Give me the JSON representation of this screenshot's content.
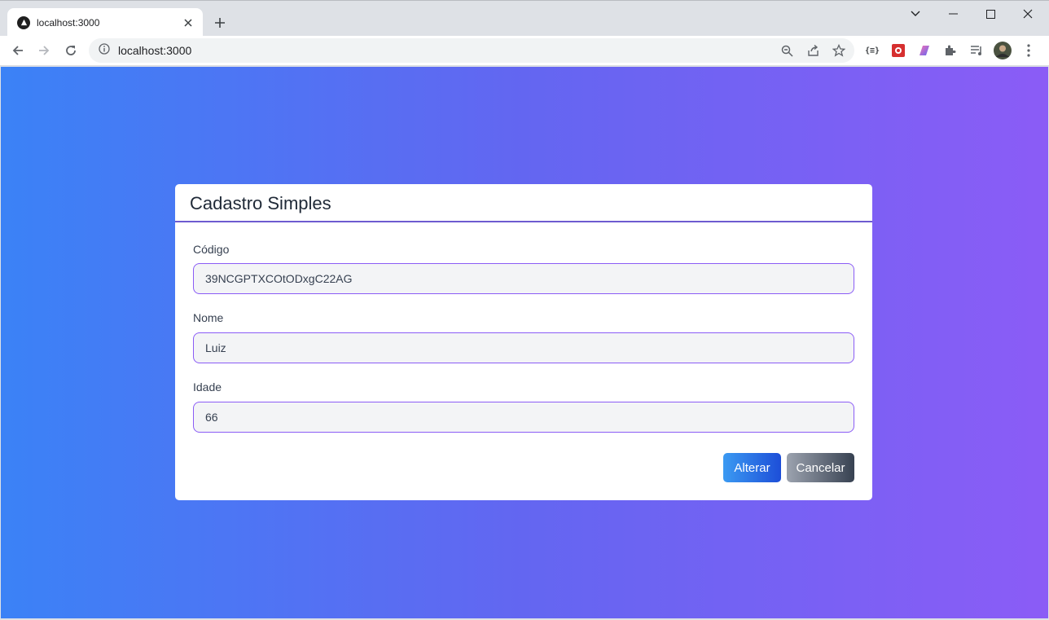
{
  "browser": {
    "tab_title": "localhost:3000",
    "url": "localhost:3000",
    "extension_code_label": "{≡}"
  },
  "form": {
    "title": "Cadastro Simples",
    "fields": [
      {
        "label": "Código",
        "value": "39NCGPTXCOtODxgC22AG"
      },
      {
        "label": "Nome",
        "value": "Luiz"
      },
      {
        "label": "Idade",
        "value": "66"
      }
    ],
    "buttons": {
      "primary": "Alterar",
      "secondary": "Cancelar"
    }
  },
  "colors": {
    "gradient_start": "#3b82f6",
    "gradient_end": "#8b5cf6",
    "input_border": "#8b5cf6",
    "primary_button": "#1d4ed8",
    "secondary_button": "#374151"
  }
}
